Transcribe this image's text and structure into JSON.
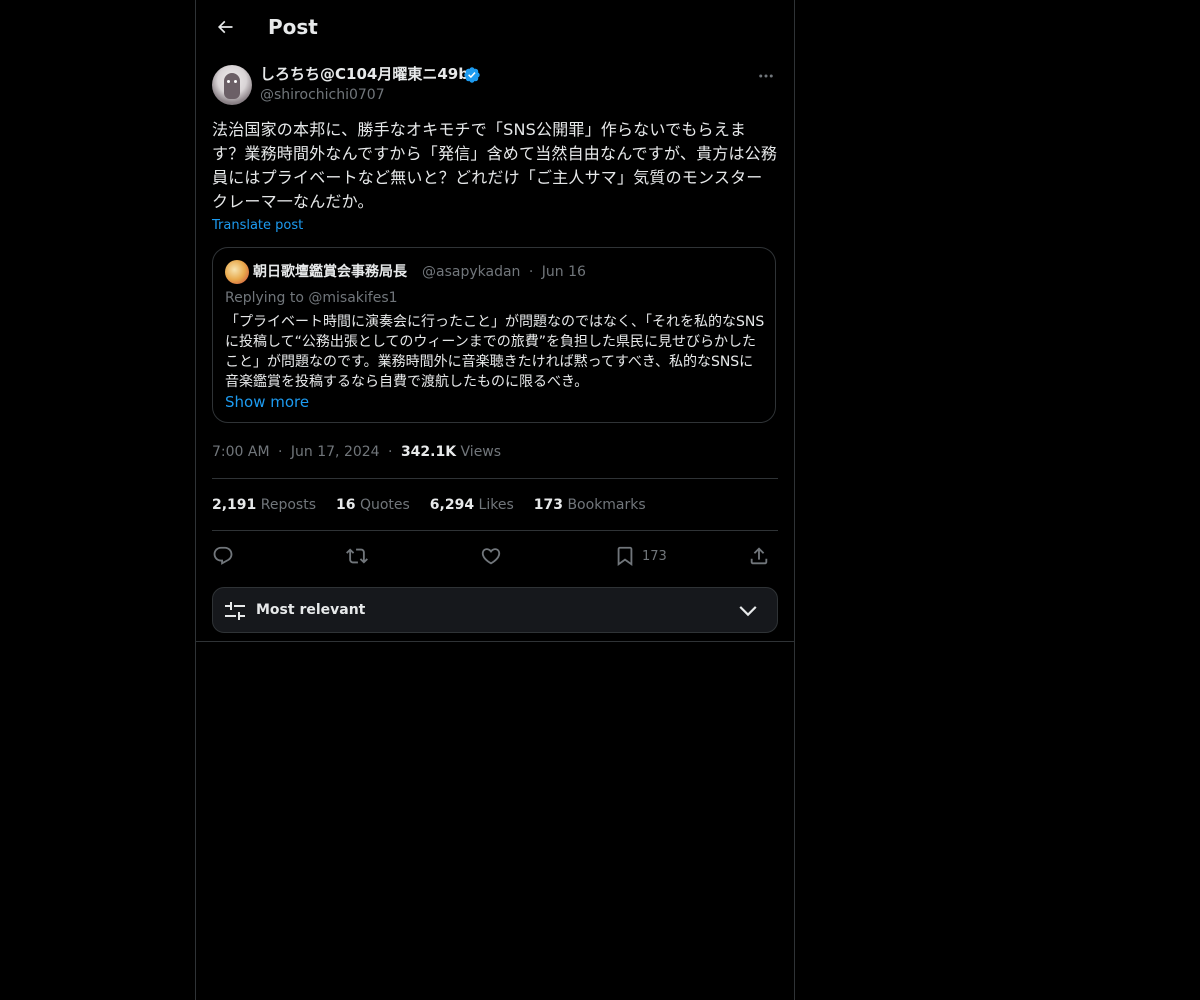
{
  "header": {
    "title": "Post"
  },
  "author": {
    "display_name": "しろちち@C104月曜東ニ49b",
    "handle": "@shirochichi0707",
    "verified": true
  },
  "post": {
    "text": "法治国家の本邦に、勝手なオキモチで「SNS公開罪」作らないでもらえます？業務時間外なんですから「発信」含めて当然自由なんですが、貴方は公務員にはプライベートなど無いと？どれだけ「ご主人サマ」気質のモンスタークレーマ一なんだか。",
    "translate_label": "Translate post"
  },
  "quote": {
    "display_name": "朝日歌壇鑑賞会事務局長",
    "handle": "@asapykadan",
    "date": "Jun 16",
    "replying_prefix": "Replying to ",
    "replying_to": "@misakifes1",
    "text": "「プライベート時間に演奏会に行ったこと」が問題なのではなく、「それを私的なSNSに投稿して“公務出張としてのウィーンまでの旅費”を負担した県民に見せびらかしたこと」が問題なのです。業務時間外に音楽聴きたければ黙ってすべき、私的なSNSに音楽鑑賞を投稿するなら自費で渡航したものに限るべき。",
    "show_more_label": "Show more"
  },
  "meta": {
    "time": "7:00 AM",
    "date": "Jun 17, 2024",
    "views_count": "342.1K",
    "views_label": "Views",
    "separator": "·"
  },
  "stats": {
    "reposts_count": "2,191",
    "reposts_label": "Reposts",
    "quotes_count": "16",
    "quotes_label": "Quotes",
    "likes_count": "6,294",
    "likes_label": "Likes",
    "bookmarks_count": "173",
    "bookmarks_label": "Bookmarks"
  },
  "actions": {
    "reply_icon": "reply-icon",
    "repost_icon": "repost-icon",
    "like_icon": "heart-icon",
    "bookmark_icon": "bookmark-icon",
    "bookmark_count": "173",
    "share_icon": "share-icon"
  },
  "sort": {
    "label": "Most relevant"
  },
  "colors": {
    "background": "#000000",
    "text": "#e7e9ea",
    "secondary_text": "#71767b",
    "accent": "#1d9bf0",
    "border": "#2f3336"
  }
}
